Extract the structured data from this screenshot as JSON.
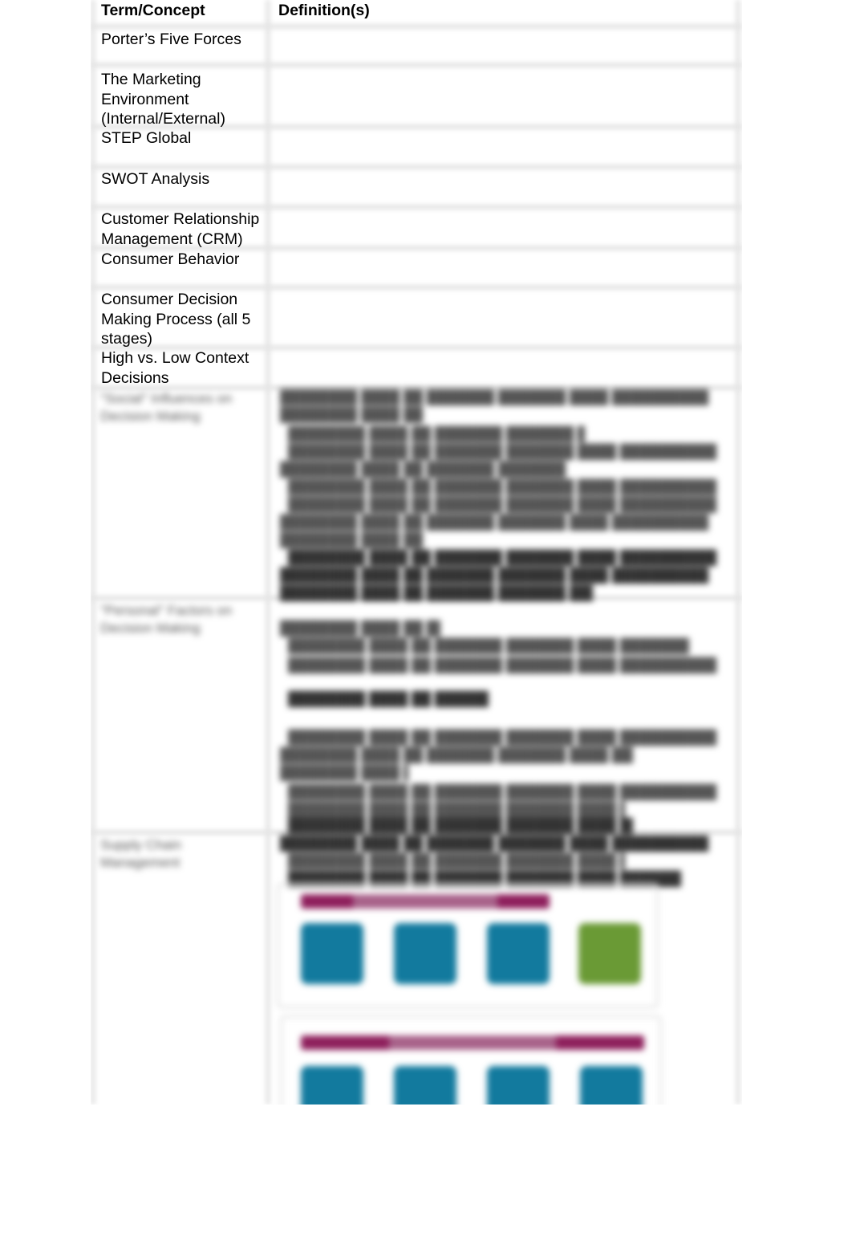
{
  "document": {
    "table": {
      "headers": {
        "term": "Term/Concept",
        "definition": "Definition(s)"
      },
      "rows": [
        {
          "term": "Porter’s Five Forces",
          "definition": ""
        },
        {
          "term": "The Marketing\nEnvironment\n(Internal/External)",
          "definition": ""
        },
        {
          "term": "STEP Global",
          "definition": ""
        },
        {
          "term": "SWOT Analysis",
          "definition": ""
        },
        {
          "term": "Customer Relationship\nManagement (CRM)",
          "definition": ""
        },
        {
          "term": "Consumer Behavior",
          "definition": ""
        },
        {
          "term": "Consumer Decision\nMaking Process (all 5\nstages)",
          "definition": ""
        },
        {
          "term": "High vs. Low Context\nDecisions",
          "definition": ""
        }
      ]
    },
    "blurred_preview": {
      "row_terms": [
        "\"Social\" Influences on Decision Making",
        "\"Personal\" Factors on Decision Making",
        "Supply Chain Management"
      ],
      "placeholder_line": "████████ ████ ██ ███████ ███████ ████ ██████████",
      "diagram_colors": {
        "banner": "#8e1f5c",
        "banner_mid": "#a8628a",
        "step": "#127a9e",
        "final_step": "#6a9a35"
      }
    }
  }
}
